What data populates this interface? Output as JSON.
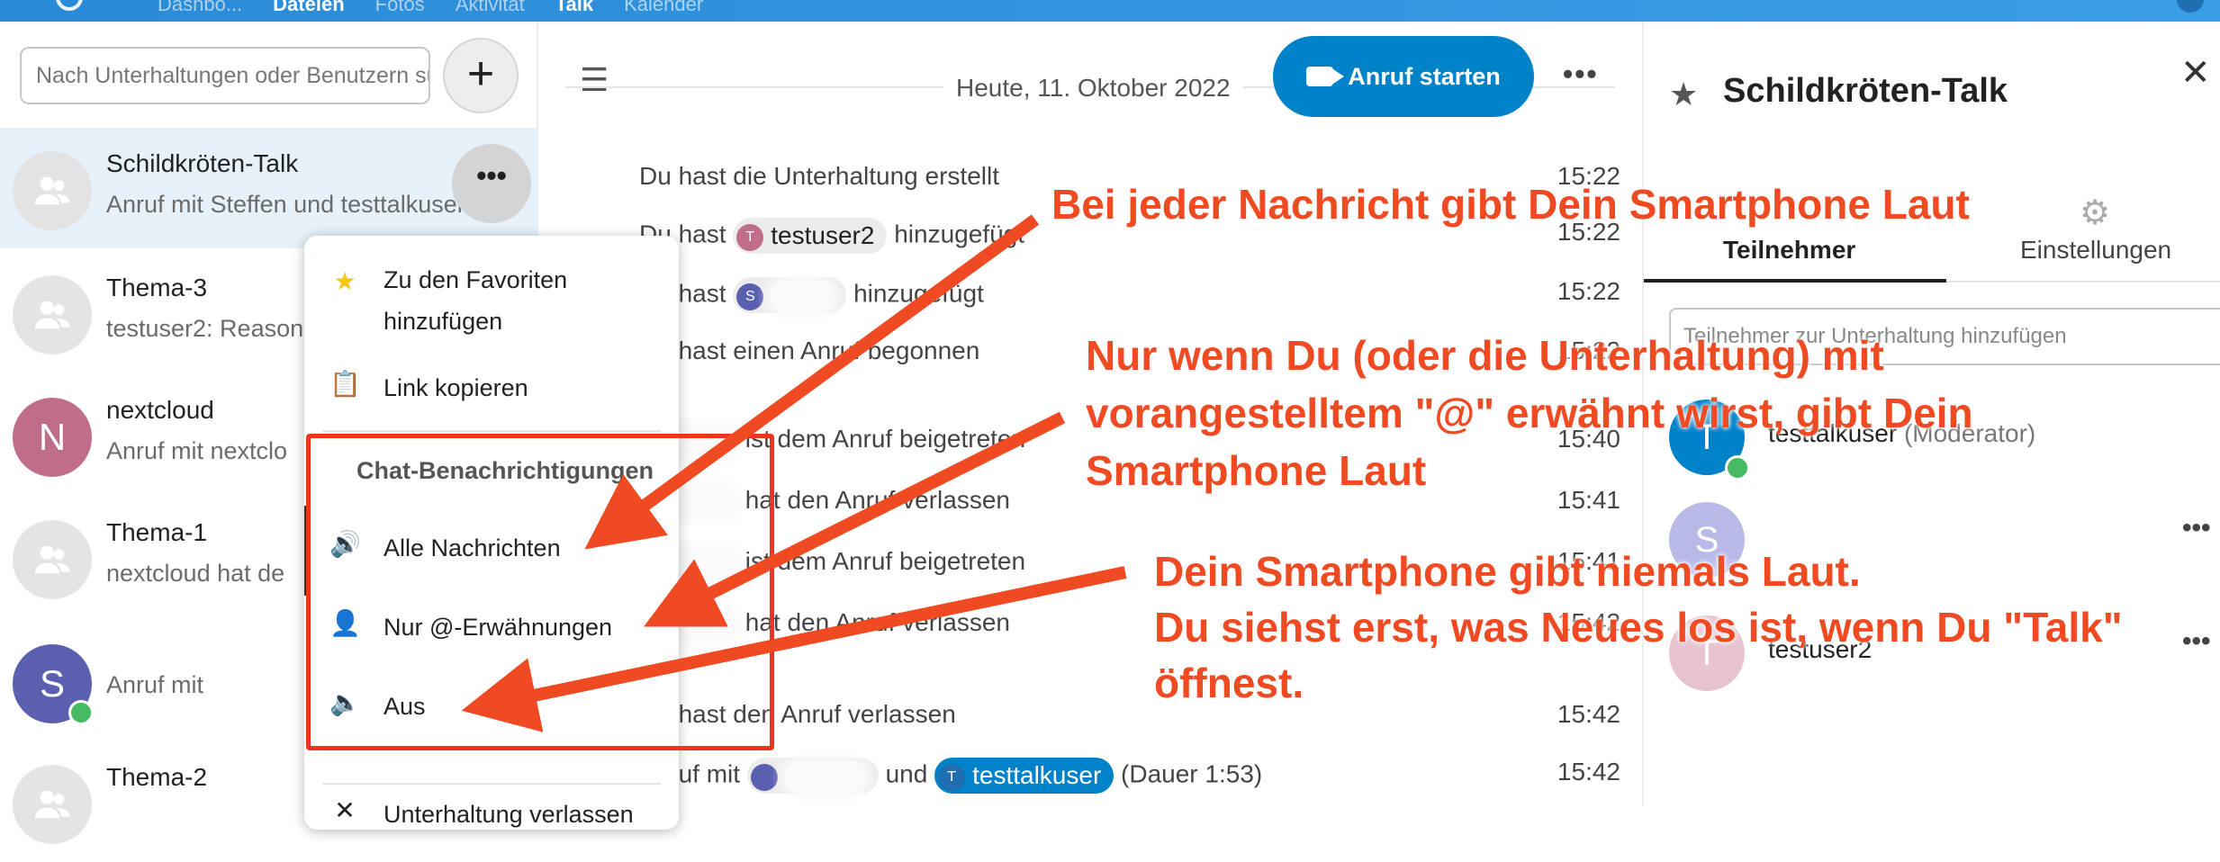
{
  "topbar": {
    "nav": [
      "Dashbo...",
      "Dateien",
      "Fotos",
      "Aktivität",
      "Talk",
      "Kalender"
    ]
  },
  "sidebar": {
    "search_placeholder": "Nach Unterhaltungen oder Benutzern suchen",
    "new_label": "+",
    "conversations": [
      {
        "name": "Schildkröten-Talk",
        "sub": "Anruf mit Steffen und testtalkuser ..."
      },
      {
        "name": "Thema-3",
        "sub": "testuser2: Reason"
      },
      {
        "name": "nextcloud",
        "sub": "Anruf mit nextclo",
        "letter": "N"
      },
      {
        "name": "Thema-1",
        "sub": "nextcloud hat de"
      },
      {
        "name": "",
        "sub": "Anruf mit",
        "letter": "S"
      },
      {
        "name": "Thema-2",
        "sub": ""
      }
    ]
  },
  "menu": {
    "favorite": "Zu den Favoriten hinzufügen",
    "copy_link": "Link kopieren",
    "heading": "Chat-Benachrichtigungen",
    "all": "Alle Nachrichten",
    "mentions": "Nur @-Erwähnungen",
    "off": "Aus",
    "leave": "Unterhaltung verlassen"
  },
  "chat": {
    "date": "Heute, 11. Oktober 2022",
    "call_button": "Anruf starten",
    "messages": [
      {
        "text": "Du hast die Unterhaltung erstellt",
        "time": "15:22"
      },
      {
        "prefix": "Du hast",
        "chip": "testuser2",
        "chip_letter": "T",
        "suffix": "hinzugefügt",
        "time": "15:22"
      },
      {
        "prefix": "Du hast",
        "chip_letter": "S",
        "suffix": "hinzugefügt",
        "time": "15:22"
      },
      {
        "text": "Du hast einen Anruf begonnen",
        "time": "15:22"
      },
      {
        "suffix": "ist dem Anruf beigetreten",
        "time": "15:40"
      },
      {
        "suffix": "hat den Anruf verlassen",
        "time": "15:41"
      },
      {
        "suffix": "ist dem Anruf beigetreten",
        "time": "15:41"
      },
      {
        "suffix": "hat den Anruf verlassen",
        "time": "15:42"
      },
      {
        "text": "Du hast den Anruf verlassen",
        "time": "15:42"
      },
      {
        "prefix": "Anruf mit",
        "mid": "und",
        "chip": "testtalkuser",
        "chip_letter": "T",
        "suffix": "(Dauer 1:53)",
        "time": "15:42"
      }
    ]
  },
  "right": {
    "title": "Schildkröten-Talk",
    "tab_participants": "Teilnehmer",
    "tab_settings": "Einstellungen",
    "add_placeholder": "Teilnehmer zur Unterhaltung hinzufügen",
    "participants": [
      {
        "name": "testtalkuser",
        "role": "(Moderator)",
        "letter": "T"
      },
      {
        "name": "",
        "role": "",
        "letter": "S"
      },
      {
        "name": "testuser2",
        "role": "",
        "letter": "T"
      }
    ]
  },
  "annotations": {
    "a1": "Bei jeder Nachricht gibt Dein Smartphone Laut",
    "a2_l1": "Nur wenn Du (oder die Unterhaltung) mit",
    "a2_l2": "vorangestelltem \"@\" erwähnt wirst, gibt Dein",
    "a2_l3": "Smartphone Laut",
    "a3_l1": "Dein Smartphone gibt niemals Laut.",
    "a3_l2": "Du siehst erst, was Neues los ist, wenn Du \"Talk\"",
    "a3_l3": "öffnest."
  },
  "colors": {
    "accent": "#0082c9",
    "annotation": "#f04a22",
    "online": "#46ba61"
  }
}
